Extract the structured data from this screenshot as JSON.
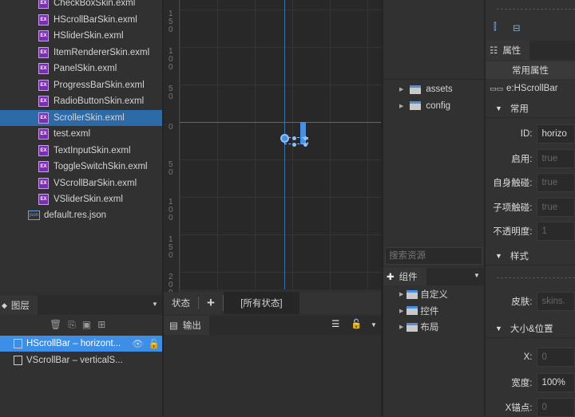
{
  "file_tree": {
    "items": [
      {
        "name": "CheckBoxSkin.exml",
        "type": "exml"
      },
      {
        "name": "HScrollBarSkin.exml",
        "type": "exml"
      },
      {
        "name": "HSliderSkin.exml",
        "type": "exml"
      },
      {
        "name": "ItemRendererSkin.exml",
        "type": "exml"
      },
      {
        "name": "PanelSkin.exml",
        "type": "exml"
      },
      {
        "name": "ProgressBarSkin.exml",
        "type": "exml"
      },
      {
        "name": "RadioButtonSkin.exml",
        "type": "exml"
      },
      {
        "name": "ScrollerSkin.exml",
        "type": "exml",
        "selected": true
      },
      {
        "name": "test.exml",
        "type": "exml"
      },
      {
        "name": "TextInputSkin.exml",
        "type": "exml"
      },
      {
        "name": "ToggleSwitchSkin.exml",
        "type": "exml"
      },
      {
        "name": "VScrollBarSkin.exml",
        "type": "exml"
      },
      {
        "name": "VSliderSkin.exml",
        "type": "exml"
      }
    ],
    "json_file": "default.res.json",
    "exml_badge": "EX",
    "json_badge": "json"
  },
  "layers": {
    "tab": "图层",
    "items": [
      "HScrollBar – horizont...",
      "VScrollBar – verticalS..."
    ],
    "selected": 0
  },
  "ruler": {
    "labels": [
      "150",
      "100",
      "50",
      "0",
      "50",
      "100",
      "150",
      "200"
    ]
  },
  "states": {
    "label": "状态",
    "add": "+",
    "all": "[所有状态]"
  },
  "output": {
    "tab": "输出"
  },
  "resources": {
    "folders": [
      "assets",
      "config"
    ],
    "search_placeholder": "搜索资源",
    "components_tab": "组件",
    "component_folders": [
      "自定义",
      "控件",
      "布局"
    ]
  },
  "properties": {
    "tab": "属性",
    "section_header": "常用属性",
    "component": "e:HScrollBar",
    "common": {
      "title": "常用",
      "fields": [
        {
          "label": "ID:",
          "value": "horizo",
          "active": true
        },
        {
          "label": "启用:",
          "value": "true"
        },
        {
          "label": "自身触碰:",
          "value": "true"
        },
        {
          "label": "子项触碰:",
          "value": "true"
        },
        {
          "label": "不透明度:",
          "value": "1"
        }
      ]
    },
    "style": {
      "title": "样式",
      "fields": [
        {
          "label": "皮肤:",
          "value": "skins."
        }
      ]
    },
    "size_pos": {
      "title": "大小&位置",
      "fields": [
        {
          "label": "X:",
          "value": "0"
        },
        {
          "label": "宽度:",
          "value": "100%",
          "active": true
        },
        {
          "label": "X锚点:",
          "value": "0"
        }
      ]
    }
  },
  "colors": {
    "selection": "#2d6aa8",
    "layer_selection": "#3d8ee6",
    "accent": "#4a90e2"
  }
}
